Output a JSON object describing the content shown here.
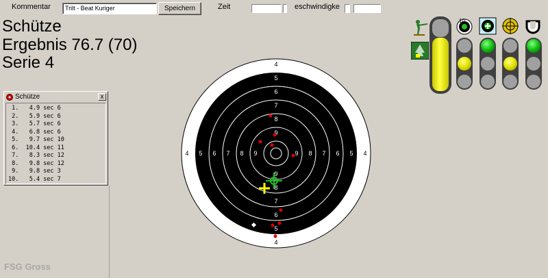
{
  "toolbar": {
    "kommentar_label": "Kommentar",
    "kommentar_value": "Trilt - Beat Kuriger",
    "save_label": "Speichern",
    "zeit_label": "Zeit",
    "geschwindigkeit_label": "eschwindigke"
  },
  "info": {
    "shooter": "Schütze",
    "result": "Ergebnis 76.7 (70)",
    "series": "Serie 4"
  },
  "panel": {
    "title": "Schütze",
    "close": "x",
    "shots": [
      " 1.   4.9 sec 6",
      " 2.   5.9 sec 6",
      " 3.   5.7 sec 6",
      " 4.   6.8 sec 6",
      " 5.   9.7 sec 10",
      " 6.  10.4 sec 11",
      " 7.   8.3 sec 12",
      " 8.   9.8 sec 12",
      " 9.   9.8 sec 3",
      "10.   5.4 sec 7"
    ]
  },
  "watermark": "FSG Gross",
  "target": {
    "ring_labels": [
      "4",
      "5",
      "6",
      "7",
      "8",
      "9"
    ],
    "colors": {
      "black": "#000000",
      "white": "#ffffff",
      "shot": "#e00000",
      "cross_green": "#20c020",
      "cross_yellow": "#ffff00"
    }
  },
  "icons": {
    "shooter_icon": "shooter-icon",
    "tree_icon": "tree-icon",
    "target_small_icon": "target-small-icon",
    "plus_icon": "plus-target-icon",
    "crosshair_icon": "crosshair-icon",
    "horseshoe_icon": "horseshoe-icon",
    "lane_number": "10"
  }
}
